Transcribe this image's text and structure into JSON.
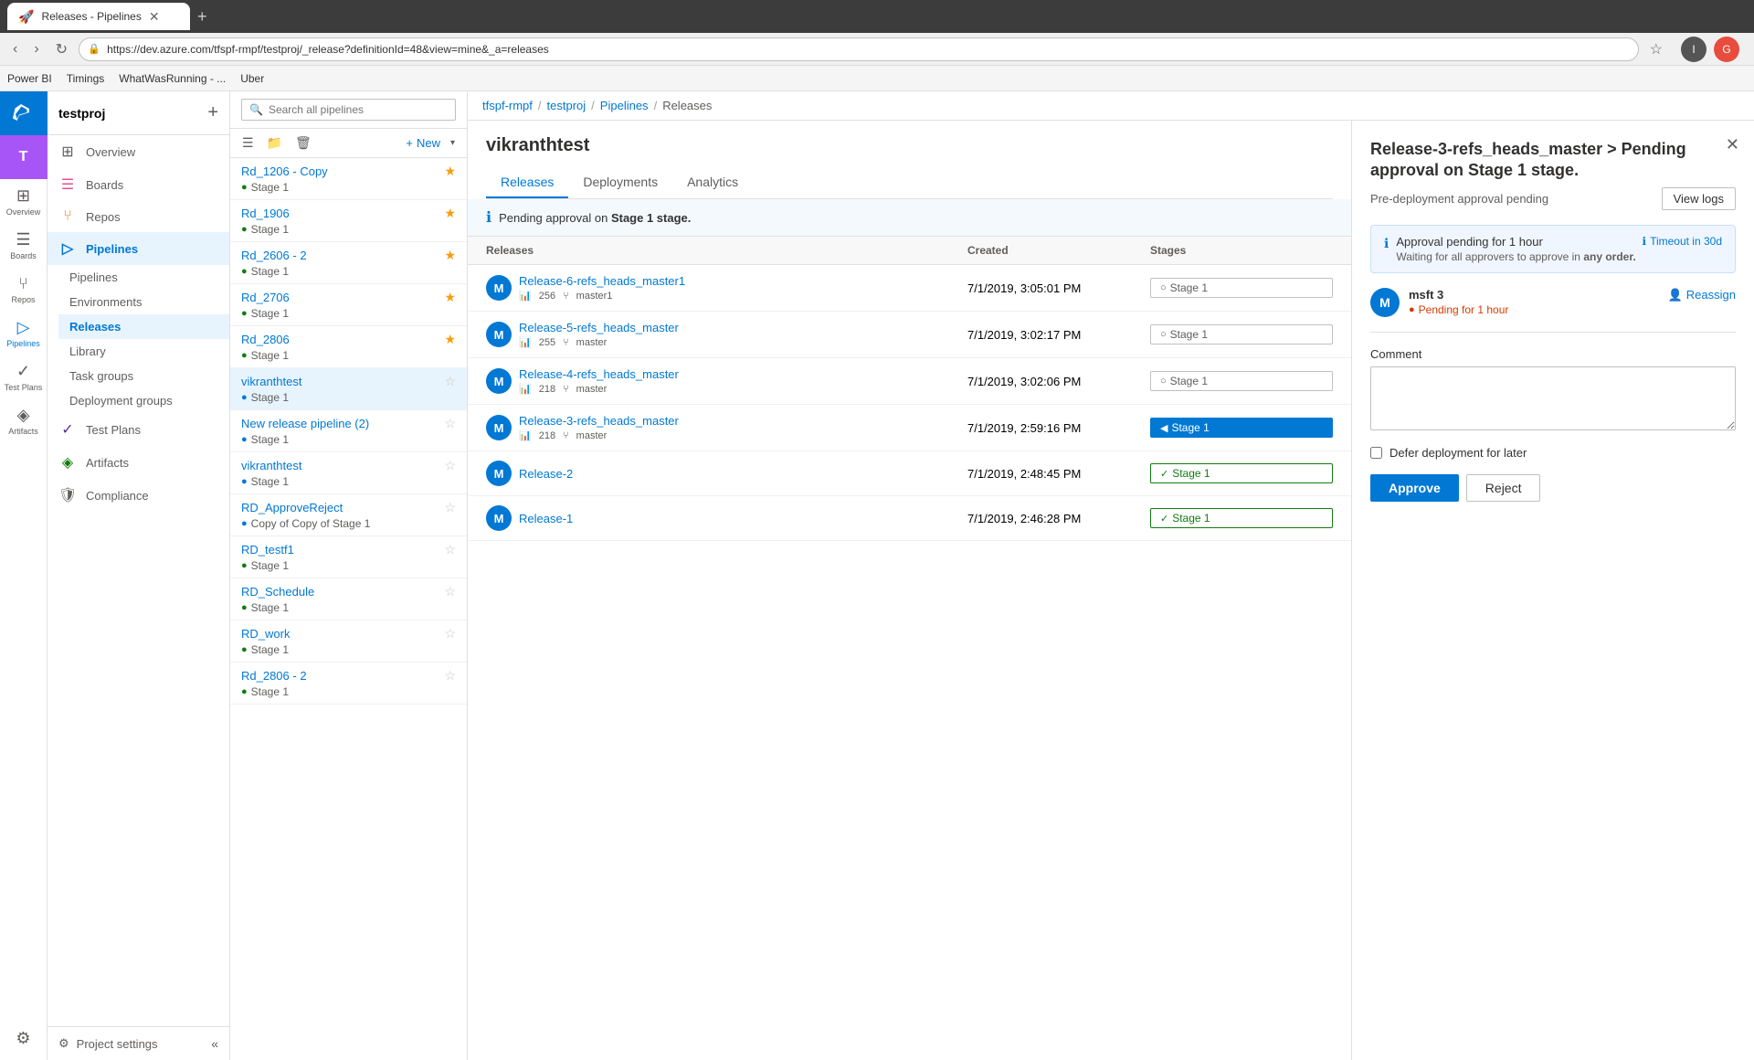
{
  "browser": {
    "tab_title": "Releases - Pipelines",
    "url": "https://dev.azure.com/tfspf-rmpf/testproj/_release?definitionId=48&view=mine&_a=releases",
    "bookmarks": [
      "Power BI",
      "Timings",
      "WhatWasRunning - ...",
      "Uber"
    ]
  },
  "sidebar": {
    "logo_text": "Azure DevOps",
    "org_initial": "T",
    "org_name": "testproj",
    "add_label": "+",
    "nav_items": [
      {
        "id": "overview",
        "icon": "⊞",
        "label": "Overview"
      },
      {
        "id": "boards",
        "icon": "☰",
        "label": "Boards"
      },
      {
        "id": "repos",
        "icon": "⑂",
        "label": "Repos"
      },
      {
        "id": "pipelines",
        "icon": "▷",
        "label": "Pipelines",
        "active": true
      },
      {
        "id": "test-plans",
        "icon": "✓",
        "label": "Test Plans"
      },
      {
        "id": "artifacts",
        "icon": "◈",
        "label": "Artifacts"
      }
    ],
    "sub_items": [
      {
        "id": "pipelines-sub",
        "label": "Pipelines"
      },
      {
        "id": "environments",
        "label": "Environments"
      },
      {
        "id": "releases",
        "label": "Releases",
        "active": true
      },
      {
        "id": "library",
        "label": "Library"
      },
      {
        "id": "task-groups",
        "label": "Task groups"
      },
      {
        "id": "deployment-groups",
        "label": "Deployment groups"
      }
    ],
    "project_settings": "Project settings",
    "collapse_icon": "«"
  },
  "breadcrumb": {
    "org": "tfspf-rmpf",
    "project": "testproj",
    "section": "Pipelines",
    "current": "Releases"
  },
  "search": {
    "placeholder": "Search all pipelines"
  },
  "toolbar": {
    "new_label": "New",
    "list_icon": "☰",
    "folder_icon": "📁",
    "delete_icon": "🗑"
  },
  "pipelines": [
    {
      "id": 1,
      "name": "Rd_1206 - Copy",
      "stage": "Stage 1",
      "status": "green",
      "starred": true
    },
    {
      "id": 2,
      "name": "Rd_1906",
      "stage": "Stage 1",
      "status": "green",
      "starred": true
    },
    {
      "id": 3,
      "name": "Rd_2606 - 2",
      "stage": "Stage 1",
      "status": "green",
      "starred": true
    },
    {
      "id": 4,
      "name": "Rd_2706",
      "stage": "Stage 1",
      "status": "green",
      "starred": true
    },
    {
      "id": 5,
      "name": "Rd_2806",
      "stage": "Stage 1",
      "status": "green",
      "starred": true
    },
    {
      "id": 6,
      "name": "vikranthtest",
      "stage": "Stage 1",
      "status": "blue",
      "starred": false,
      "active": true
    },
    {
      "id": 7,
      "name": "New release pipeline (2)",
      "stage": "Stage 1",
      "status": "blue",
      "starred": false
    },
    {
      "id": 8,
      "name": "vikranthtest",
      "stage": "Stage 1",
      "status": "blue",
      "starred": false
    },
    {
      "id": 9,
      "name": "RD_ApproveReject",
      "stage": "Copy of Copy of Stage 1",
      "status": "blue",
      "starred": false
    },
    {
      "id": 10,
      "name": "RD_testf1",
      "stage": "Stage 1",
      "status": "green",
      "starred": false
    },
    {
      "id": 11,
      "name": "RD_Schedule",
      "stage": "Stage 1",
      "status": "green",
      "starred": false
    },
    {
      "id": 12,
      "name": "RD_work",
      "stage": "Stage 1",
      "status": "green",
      "starred": false
    },
    {
      "id": 13,
      "name": "Rd_2806 - 2",
      "stage": "Stage 1",
      "status": "green",
      "starred": false
    }
  ],
  "release_detail": {
    "title": "vikranthtest",
    "tabs": [
      "Releases",
      "Deployments",
      "Analytics"
    ],
    "active_tab": "Releases",
    "info_banner": "Pending approval on Stage 1 stage.",
    "table_headers": [
      "Releases",
      "Created",
      "Stages"
    ],
    "releases": [
      {
        "id": 1,
        "avatar": "M",
        "name": "Release-6-refs_heads_master1",
        "build_num": "256",
        "branch": "master1",
        "created": "7/1/2019, 3:05:01 PM",
        "stage": "Stage 1",
        "stage_status": "none"
      },
      {
        "id": 2,
        "avatar": "M",
        "name": "Release-5-refs_heads_master",
        "build_num": "255",
        "branch": "master",
        "created": "7/1/2019, 3:02:17 PM",
        "stage": "Stage 1",
        "stage_status": "none"
      },
      {
        "id": 3,
        "avatar": "M",
        "name": "Release-4-refs_heads_master",
        "build_num": "218",
        "branch": "master",
        "created": "7/1/2019, 3:02:06 PM",
        "stage": "Stage 1",
        "stage_status": "none"
      },
      {
        "id": 4,
        "avatar": "M",
        "name": "Release-3-refs_heads_master",
        "build_num": "218",
        "branch": "master",
        "created": "7/1/2019, 2:59:16 PM",
        "stage": "Stage 1",
        "stage_status": "active"
      },
      {
        "id": 5,
        "avatar": "M",
        "name": "Release-2",
        "build_num": "",
        "branch": "",
        "created": "7/1/2019, 2:48:45 PM",
        "stage": "Stage 1",
        "stage_status": "success"
      },
      {
        "id": 6,
        "avatar": "M",
        "name": "Release-1",
        "build_num": "",
        "branch": "",
        "created": "7/1/2019, 2:46:28 PM",
        "stage": "Stage 1",
        "stage_status": "success"
      }
    ]
  },
  "approval": {
    "title": "Release-3-refs_heads_master > Pending approval on Stage 1 stage.",
    "subtitle": "Pre-deployment approval pending",
    "view_logs_label": "View logs",
    "info_title": "Approval pending for 1 hour",
    "info_desc": "Waiting for all approvers to approve in",
    "info_order": "any order.",
    "timeout_label": "Timeout in 30d",
    "approver_name": "msft 3",
    "approver_status": "Pending for 1 hour",
    "reassign_label": "Reassign",
    "comment_label": "Comment",
    "comment_placeholder": "",
    "defer_label": "Defer deployment for later",
    "approve_label": "Approve",
    "reject_label": "Reject",
    "approver_initial": "M"
  }
}
